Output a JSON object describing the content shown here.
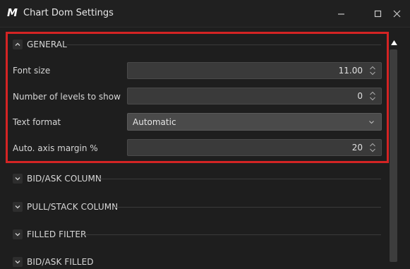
{
  "window": {
    "title": "Chart Dom Settings",
    "logo_text": "M"
  },
  "sections": [
    {
      "label": "GENERAL",
      "expanded": true
    },
    {
      "label": "BID/ASK COLUMN",
      "expanded": false
    },
    {
      "label": "PULL/STACK COLUMN",
      "expanded": false
    },
    {
      "label": "FILLED FILTER",
      "expanded": false
    },
    {
      "label": "BID/ASK FILLED",
      "expanded": false
    }
  ],
  "general": {
    "font_size": {
      "label": "Font size",
      "value": "11.00"
    },
    "levels": {
      "label": "Number of levels to show",
      "value": "0"
    },
    "text_format": {
      "label": "Text format",
      "value": "Automatic"
    },
    "axis_margin": {
      "label": "Auto. axis margin %",
      "value": "20"
    }
  },
  "colors": {
    "highlight": "#d42424",
    "background": "#1e1e1e",
    "field": "#3a3a3a"
  }
}
